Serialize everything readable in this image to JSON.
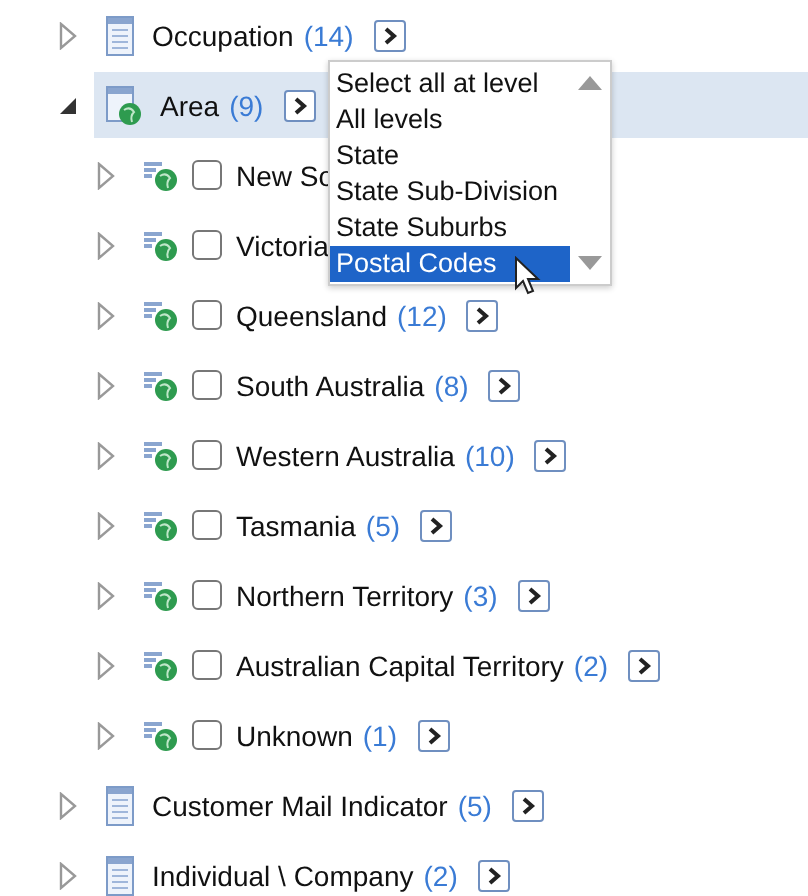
{
  "tree": [
    {
      "label": "Occupation",
      "count": "(14)",
      "kind": "table",
      "expanded": false,
      "selected": false,
      "more_button": true
    },
    {
      "label": "Area",
      "count": "(9)",
      "kind": "geo-table",
      "expanded": true,
      "selected": true,
      "more_button": true,
      "children": [
        {
          "label": "New So",
          "kind": "geo-level",
          "checked": false,
          "expanded": false,
          "more_button": false
        },
        {
          "label": "Victoria",
          "kind": "geo-level",
          "checked": false,
          "expanded": false,
          "more_button": false
        },
        {
          "label": "Queensland",
          "count": "(12)",
          "kind": "geo-level",
          "checked": false,
          "expanded": false,
          "more_button": true
        },
        {
          "label": "South Australia",
          "count": "(8)",
          "kind": "geo-level",
          "checked": false,
          "expanded": false,
          "more_button": true
        },
        {
          "label": "Western Australia",
          "count": "(10)",
          "kind": "geo-level",
          "checked": false,
          "expanded": false,
          "more_button": true
        },
        {
          "label": "Tasmania",
          "count": "(5)",
          "kind": "geo-level",
          "checked": false,
          "expanded": false,
          "more_button": true
        },
        {
          "label": "Northern Territory",
          "count": "(3)",
          "kind": "geo-level",
          "checked": false,
          "expanded": false,
          "more_button": true
        },
        {
          "label": "Australian Capital Territory",
          "count": "(2)",
          "kind": "geo-level",
          "checked": false,
          "expanded": false,
          "more_button": true
        },
        {
          "label": "Unknown",
          "count": "(1)",
          "kind": "geo-level",
          "checked": false,
          "expanded": false,
          "more_button": true
        }
      ]
    },
    {
      "label": "Customer Mail Indicator",
      "count": "(5)",
      "kind": "table",
      "expanded": false,
      "selected": false,
      "more_button": true
    },
    {
      "label": "Individual \\ Company",
      "count": "(2)",
      "kind": "table",
      "expanded": false,
      "selected": false,
      "more_button": true
    }
  ],
  "level_menu": {
    "options": [
      {
        "label": "Select all at level",
        "selected": false
      },
      {
        "label": "All levels",
        "selected": false
      },
      {
        "label": "State",
        "selected": false
      },
      {
        "label": "State Sub-Division",
        "selected": false
      },
      {
        "label": "State Suburbs",
        "selected": false
      },
      {
        "label": "Postal Codes",
        "selected": true
      }
    ]
  }
}
